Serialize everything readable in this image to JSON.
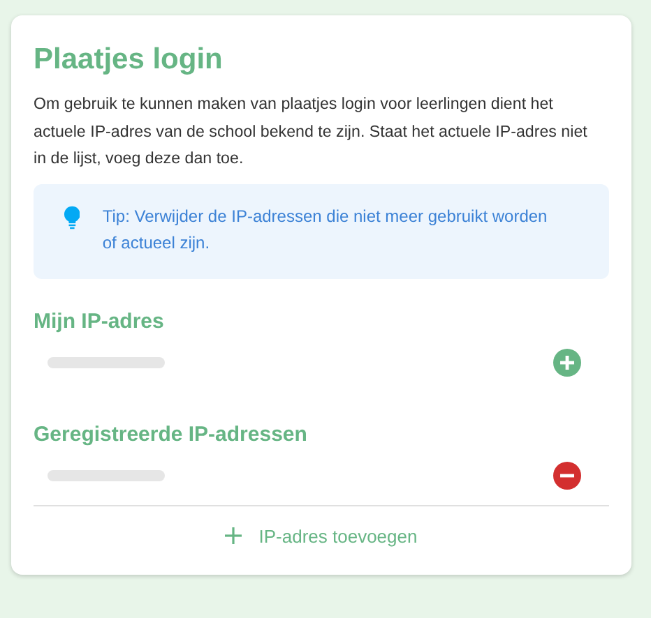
{
  "title": "Plaatjes login",
  "intro": "Om gebruik te kunnen maken van plaatjes login voor leerlingen dient het actuele IP-adres van de school bekend te zijn. Staat het actuele IP-adres niet in de lijst, voeg deze dan toe.",
  "tip": "Tip: Verwijder de IP-adressen die niet meer gebruikt worden of actueel zijn.",
  "sections": [
    {
      "heading": "Mijn IP-adres",
      "rows": [
        {
          "kind": "add"
        }
      ]
    },
    {
      "heading": "Geregistreerde IP-adressen",
      "rows": [
        {
          "kind": "remove"
        }
      ]
    }
  ],
  "add_button": {
    "label": "IP-adres toevoegen"
  }
}
